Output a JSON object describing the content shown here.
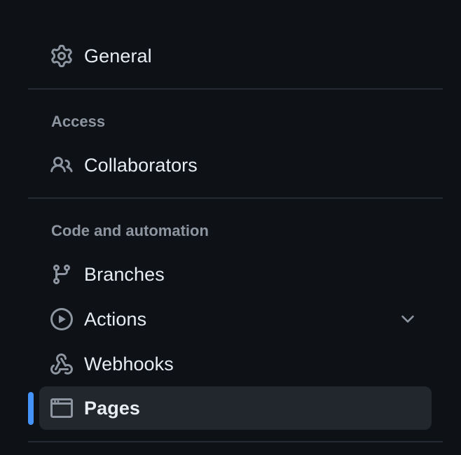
{
  "sidebar": {
    "items": {
      "general": {
        "label": "General",
        "icon": "gear-icon"
      },
      "collaborators": {
        "label": "Collaborators",
        "icon": "people-icon"
      },
      "branches": {
        "label": "Branches",
        "icon": "git-branch-icon"
      },
      "actions": {
        "label": "Actions",
        "icon": "play-icon",
        "expandable": true
      },
      "webhooks": {
        "label": "Webhooks",
        "icon": "webhook-icon"
      },
      "pages": {
        "label": "Pages",
        "icon": "browser-icon",
        "selected": true
      }
    },
    "groups": {
      "access": "Access",
      "code_and_automation": "Code and automation"
    }
  },
  "colors": {
    "background": "#0e1116",
    "selected_background": "#22262d",
    "accent": "#4493f8",
    "text": "#e6edf3",
    "muted": "#8d96a0",
    "divider": "#262b33"
  }
}
